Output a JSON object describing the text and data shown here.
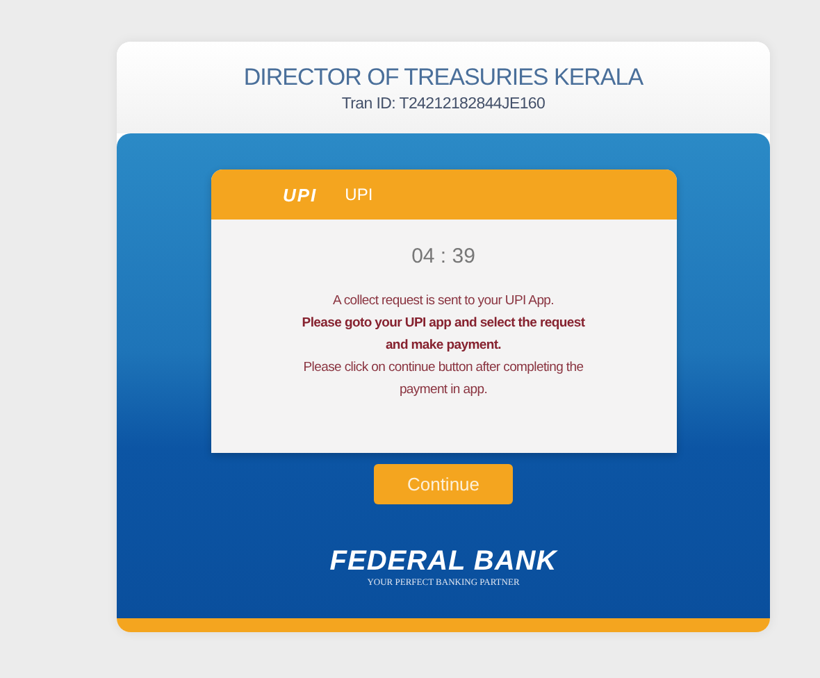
{
  "header": {
    "title": "DIRECTOR OF TREASURIES KERALA",
    "tran_id": "Tran ID: T24212182844JE160"
  },
  "payment_card": {
    "logo_text": "UPI",
    "method": "UPI",
    "timer": "04 : 39",
    "messages": [
      {
        "text": "A collect request is sent to your UPI App.",
        "bold": false
      },
      {
        "text": "Please goto your UPI app and select the request and make payment.",
        "bold": true
      },
      {
        "text": "Please click on continue button after completing the payment in app.",
        "bold": false
      }
    ]
  },
  "button": "Continue",
  "bank": {
    "name": "FEDERAL BANK",
    "tagline": "YOUR PERFECT BANKING PARTNER"
  }
}
